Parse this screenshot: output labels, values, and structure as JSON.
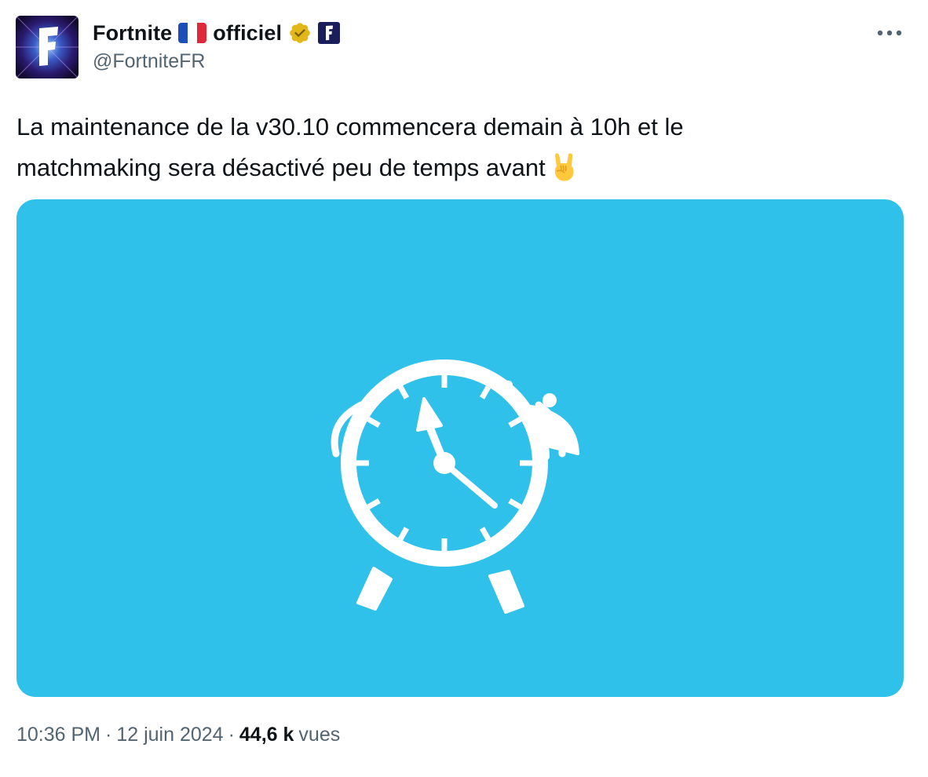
{
  "author": {
    "name_part1": "Fortnite",
    "name_part2": "officiel",
    "handle": "@FortniteFR",
    "flag": "france-flag",
    "verified": "gold-verified-badge",
    "affiliate_badge": "fortnite-f-logo"
  },
  "more_menu_icon": "more-options-icon",
  "tweet": {
    "text_line1": "La maintenance de la v30.10 commencera demain à 10h et le",
    "text_line2": "matchmaking sera désactivé peu de temps avant",
    "emoji": "sign-of-the-horns-emoji"
  },
  "media": {
    "background_color": "#2fc1ea",
    "illustration": "alarm-clock-icon"
  },
  "meta": {
    "time": "10:36 PM",
    "separator1": "·",
    "date": "12 juin 2024",
    "separator2": "·",
    "views_count": "44,6 k",
    "views_label": "vues"
  },
  "colors": {
    "text_primary": "#0f1419",
    "text_secondary": "#536471",
    "verified_gold": "#e2b719",
    "media_blue": "#2fc1ea"
  }
}
